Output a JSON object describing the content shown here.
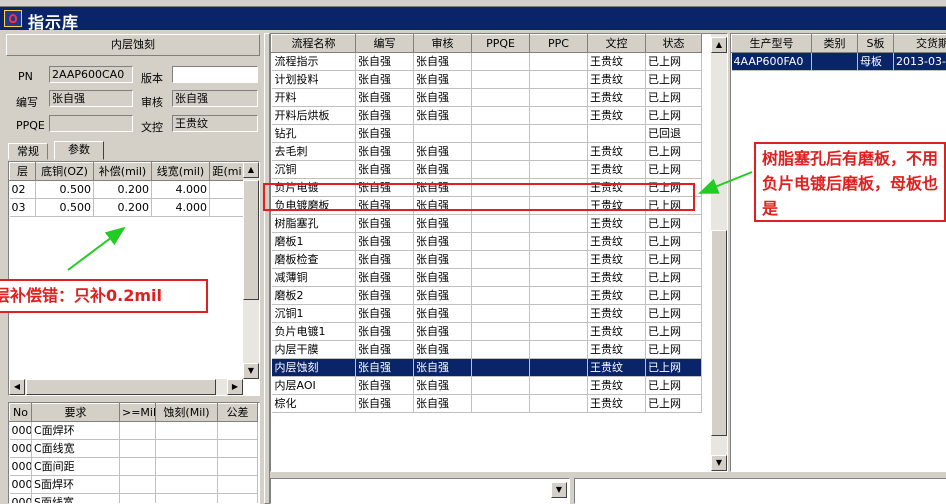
{
  "window": {
    "title": "指示库"
  },
  "left": {
    "header": "内层蚀刻",
    "pn_label": "PN",
    "pn_value": "2AAP600CA0",
    "version_label": "版本",
    "version_value": "",
    "editor_label": "编写",
    "editor_value": "张自强",
    "reviewer_label": "审核",
    "reviewer_value": "张自强",
    "ppqe_label": "PPQE",
    "ppqe_value": "",
    "doc_label": "文控",
    "doc_value": "王贵纹",
    "tabs": [
      "常规",
      "参数"
    ],
    "param_headers": [
      "层",
      "底铜(OZ)",
      "补偿(mil)",
      "线宽(mil)",
      "距(mi"
    ],
    "param_rows": [
      [
        "02",
        "0.500",
        "0.200",
        "4.000",
        ""
      ],
      [
        "03",
        "0.500",
        "0.200",
        "4.000",
        ""
      ]
    ],
    "req_headers": [
      "No",
      "要求",
      ">=Mil",
      "蚀刻(Mil)",
      "公差"
    ],
    "req_rows": [
      [
        "000",
        "C面焊环"
      ],
      [
        "000",
        "C面线宽"
      ],
      [
        "000",
        "C面间距"
      ],
      [
        "000",
        "S面焊环"
      ],
      [
        "000",
        "S面线宽"
      ]
    ]
  },
  "main": {
    "headers": [
      "流程名称",
      "编写",
      "审核",
      "PPQE",
      "PPC",
      "文控",
      "状态"
    ],
    "rows": [
      [
        "流程指示",
        "张自强",
        "张自强",
        "",
        "",
        "王贵纹",
        "已上网"
      ],
      [
        "计划投料",
        "张自强",
        "张自强",
        "",
        "",
        "王贵纹",
        "已上网"
      ],
      [
        "开料",
        "张自强",
        "张自强",
        "",
        "",
        "王贵纹",
        "已上网"
      ],
      [
        "开料后烘板",
        "张自强",
        "张自强",
        "",
        "",
        "王贵纹",
        "已上网"
      ],
      [
        "钻孔",
        "张自强",
        "",
        "",
        "",
        "",
        "已回退"
      ],
      [
        "去毛刺",
        "张自强",
        "张自强",
        "",
        "",
        "王贵纹",
        "已上网"
      ],
      [
        "沉铜",
        "张自强",
        "张自强",
        "",
        "",
        "王贵纹",
        "已上网"
      ],
      [
        "负片电镀",
        "张自强",
        "张自强",
        "",
        "",
        "王贵纹",
        "已上网"
      ],
      [
        "负电镀磨板",
        "张自强",
        "张自强",
        "",
        "",
        "王贵纹",
        "已上网"
      ],
      [
        "树脂塞孔",
        "张自强",
        "张自强",
        "",
        "",
        "王贵纹",
        "已上网"
      ],
      [
        "磨板1",
        "张自强",
        "张自强",
        "",
        "",
        "王贵纹",
        "已上网"
      ],
      [
        "磨板检查",
        "张自强",
        "张自强",
        "",
        "",
        "王贵纹",
        "已上网"
      ],
      [
        "减薄铜",
        "张自强",
        "张自强",
        "",
        "",
        "王贵纹",
        "已上网"
      ],
      [
        "磨板2",
        "张自强",
        "张自强",
        "",
        "",
        "王贵纹",
        "已上网"
      ],
      [
        "沉铜1",
        "张自强",
        "张自强",
        "",
        "",
        "王贵纹",
        "已上网"
      ],
      [
        "负片电镀1",
        "张自强",
        "张自强",
        "",
        "",
        "王贵纹",
        "已上网"
      ],
      [
        "内层干膜",
        "张自强",
        "张自强",
        "",
        "",
        "王贵纹",
        "已上网"
      ],
      [
        "内层蚀刻",
        "张自强",
        "张自强",
        "",
        "",
        "王贵纹",
        "已上网"
      ],
      [
        "内层AOI",
        "张自强",
        "张自强",
        "",
        "",
        "王贵纹",
        "已上网"
      ],
      [
        "棕化",
        "张自强",
        "张自强",
        "",
        "",
        "王贵纹",
        "已上网"
      ]
    ],
    "selected_index": 17
  },
  "right": {
    "headers": [
      "生产型号",
      "类别",
      "S板",
      "交货期"
    ],
    "rows": [
      [
        "4AAP600FA0",
        "",
        "母板",
        "2013-03-0"
      ]
    ]
  },
  "annotations": {
    "compensation": "层补偿错：只补0.2mil",
    "grinding": "树脂塞孔后有磨板，不用负片电镀后磨板，母板也是"
  },
  "colors": {
    "selection": "#0a246a",
    "annotation": "#e02020",
    "arrow": "#22cc22"
  }
}
